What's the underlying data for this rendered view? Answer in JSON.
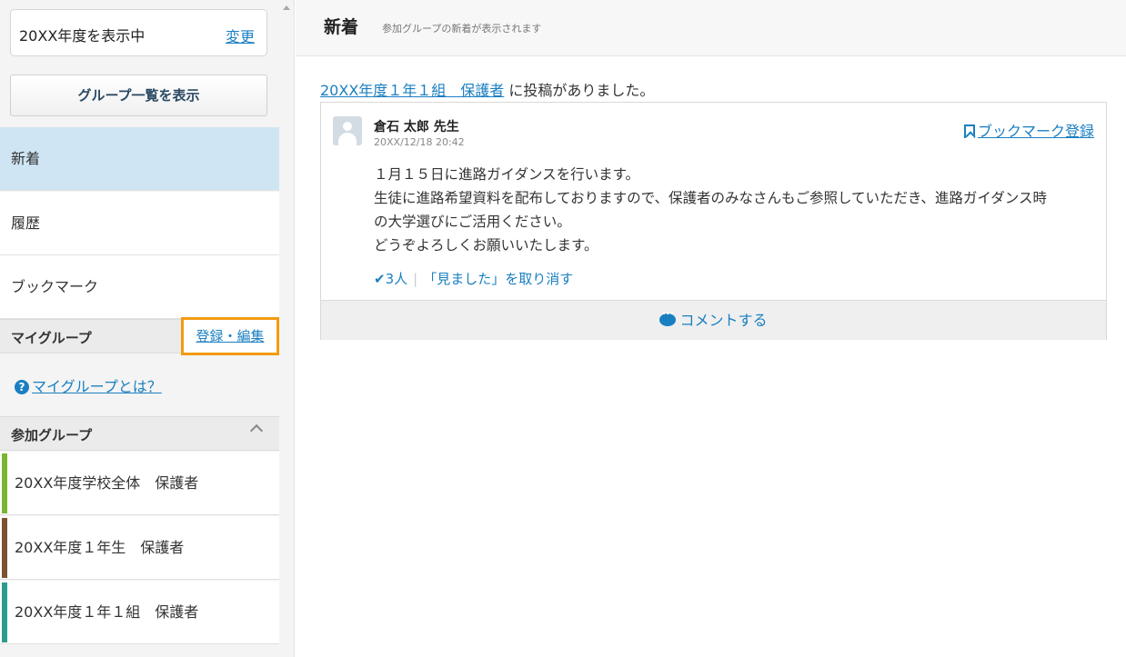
{
  "sidebar": {
    "year_display": "20XX年度を表示中",
    "change_link": "変更",
    "group_list_button": "グループ一覧を表示",
    "nav": [
      {
        "label": "新着"
      },
      {
        "label": "履歴"
      },
      {
        "label": "ブックマーク"
      }
    ],
    "my_group": {
      "title": "マイグループ",
      "edit_link": "登録・編集",
      "help_link": "マイグループとは？",
      "help_icon": "?"
    },
    "joined": {
      "title": "参加グループ",
      "groups": [
        {
          "label": "20XX年度学校全体　保護者",
          "color": "#7ab530"
        },
        {
          "label": "20XX年度１年生　保護者",
          "color": "#7a5430"
        },
        {
          "label": "20XX年度１年１組　保護者",
          "color": "#2a9d8f"
        }
      ]
    }
  },
  "main": {
    "title": "新着",
    "subtitle": "参加グループの新着が表示されます",
    "post_group_link": "20XX年度１年１組　保護者",
    "post_suffix": " に投稿がありました。",
    "post": {
      "author": "倉石 太郎 先生",
      "date": "20XX/12/18 20:42",
      "bookmark": "ブックマーク登録",
      "body": [
        "１月１５日に進路ガイダンスを行います。",
        "生徒に進路希望資料を配布しておりますので、保護者のみなさんもご参照していただき、進路ガイダンス時",
        "の大学選びにご活用ください。",
        "どうぞよろしくお願いいたします。"
      ],
      "seen_count": "3人",
      "undo_seen": "「見ました」を取り消す",
      "comment_button": "コメントする"
    }
  }
}
